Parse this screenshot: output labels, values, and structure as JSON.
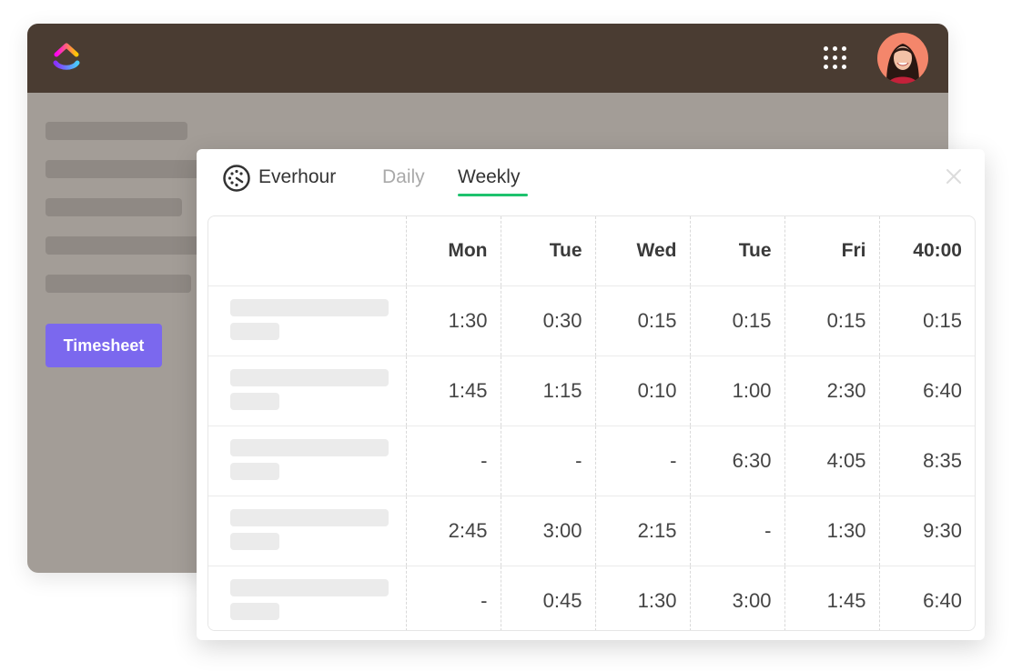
{
  "app": {
    "timesheet_label": "Timesheet",
    "accent": "#7b68ee",
    "header_color": "#4a3c32"
  },
  "panel": {
    "brand": "Everhour",
    "tabs": [
      {
        "label": "Daily",
        "active": false
      },
      {
        "label": "Weekly",
        "active": true
      }
    ],
    "active_tab_color": "#1ec26e"
  },
  "table": {
    "headers": [
      "Mon",
      "Tue",
      "Wed",
      "Tue",
      "Fri",
      "40:00"
    ],
    "rows": [
      [
        "1:30",
        "0:30",
        "0:15",
        "0:15",
        "0:15",
        "0:15"
      ],
      [
        "1:45",
        "1:15",
        "0:10",
        "1:00",
        "2:30",
        "6:40"
      ],
      [
        "-",
        "-",
        "-",
        "6:30",
        "4:05",
        "8:35"
      ],
      [
        "2:45",
        "3:00",
        "2:15",
        "-",
        "1:30",
        "9:30"
      ],
      [
        "-",
        "0:45",
        "1:30",
        "3:00",
        "1:45",
        "6:40"
      ]
    ]
  }
}
